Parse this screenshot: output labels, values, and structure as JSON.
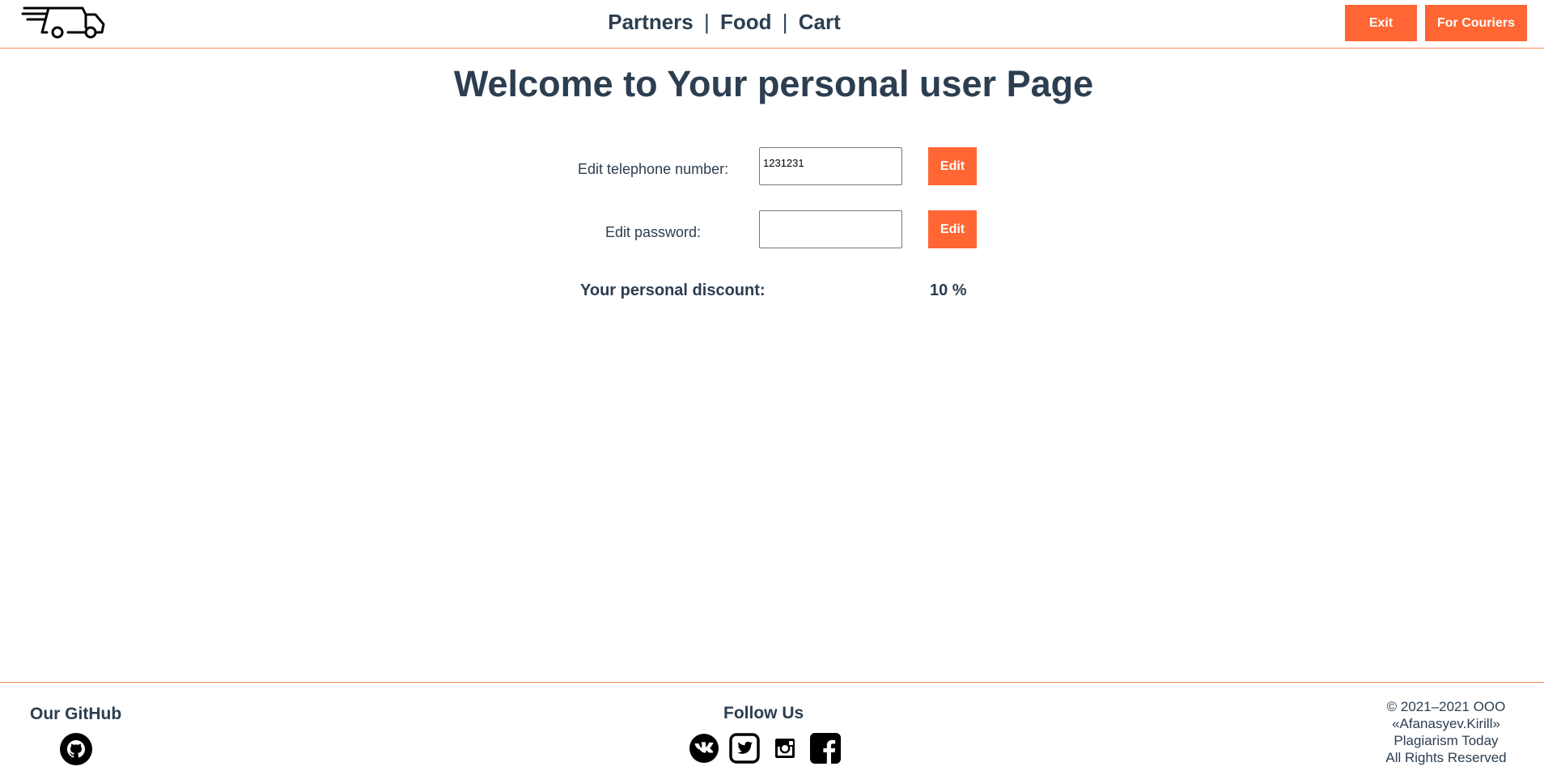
{
  "header": {
    "logo_icon": "delivery-truck-icon",
    "nav": [
      {
        "label": "Partners"
      },
      {
        "label": "Food"
      },
      {
        "label": "Cart"
      }
    ],
    "nav_separator": "|",
    "exit_label": "Exit",
    "couriers_label": "For Couriers"
  },
  "main": {
    "title": "Welcome to Your personal user Page",
    "phone": {
      "label": "Edit telephone number:",
      "value": "1231231",
      "button_label": "Edit"
    },
    "password": {
      "label": "Edit password:",
      "value": "",
      "button_label": "Edit"
    },
    "discount": {
      "label": "Your personal discount:",
      "value": "10 %"
    }
  },
  "footer": {
    "github_heading": "Our GitHub",
    "github_icon": "github-icon",
    "follow_heading": "Follow Us",
    "social_icons": [
      "vk-icon",
      "twitter-icon",
      "instagram-icon",
      "facebook-icon"
    ],
    "copyright_lines": [
      "© 2021–2021 ООО",
      "«Afanasyev.Kirill»",
      "Plagiarism Today",
      "All Rights Reserved"
    ]
  },
  "colors": {
    "accent": "#ff6633",
    "divider": "#ff8a5c",
    "text": "#2c3e50"
  }
}
